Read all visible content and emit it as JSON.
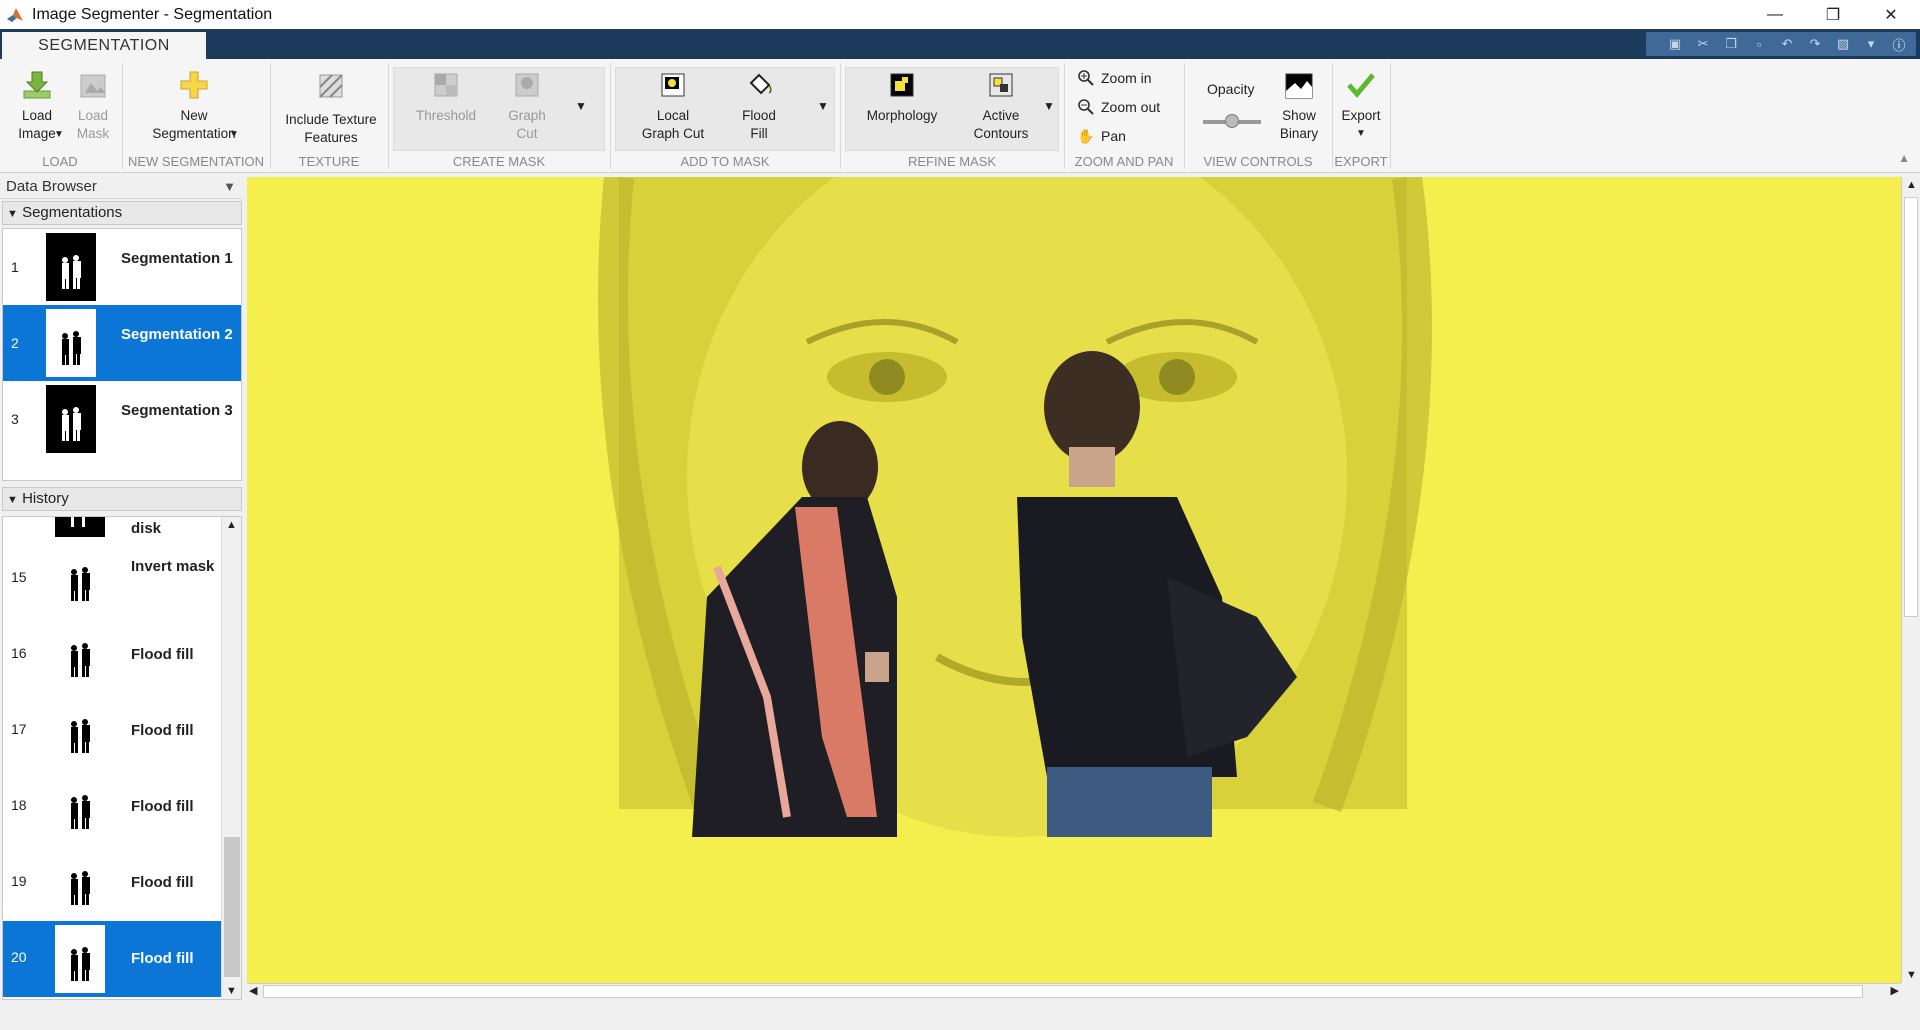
{
  "window": {
    "title": "Image Segmenter - Segmentation"
  },
  "tabs": {
    "active": "SEGMENTATION"
  },
  "toolstrip": {
    "load": {
      "label": "LOAD",
      "load_image": "Load\nImage",
      "load_mask": "Load\nMask"
    },
    "new_segmentation": {
      "label": "NEW SEGMENTATION",
      "button": "New\nSegmentation"
    },
    "texture": {
      "label": "TEXTURE",
      "button": "Include Texture\nFeatures"
    },
    "create_mask": {
      "label": "CREATE MASK",
      "threshold": "Threshold",
      "graph_cut": "Graph\nCut"
    },
    "add_to_mask": {
      "label": "ADD TO MASK",
      "local_graph_cut": "Local\nGraph Cut",
      "flood_fill": "Flood\nFill"
    },
    "refine_mask": {
      "label": "REFINE MASK",
      "morphology": "Morphology",
      "active_contours": "Active\nContours"
    },
    "zoom_pan": {
      "label": "ZOOM AND PAN",
      "zoom_in": "Zoom in",
      "zoom_out": "Zoom out",
      "pan": "Pan"
    },
    "view_controls": {
      "label": "VIEW CONTROLS",
      "opacity": "Opacity",
      "show_binary": "Show\nBinary"
    },
    "export": {
      "label": "EXPORT",
      "button": "Export"
    }
  },
  "data_browser": {
    "title": "Data Browser",
    "segmentations_header": "Segmentations",
    "segmentations": [
      {
        "num": "1",
        "label": "Segmentation 1",
        "thumb": "black"
      },
      {
        "num": "2",
        "label": "Segmentation 2",
        "thumb": "white"
      },
      {
        "num": "3",
        "label": "Segmentation 3",
        "thumb": "black"
      }
    ],
    "history_header": "History",
    "history": [
      {
        "num": "",
        "label": "disk"
      },
      {
        "num": "15",
        "label": "Invert mask"
      },
      {
        "num": "16",
        "label": "Flood fill"
      },
      {
        "num": "17",
        "label": "Flood fill"
      },
      {
        "num": "18",
        "label": "Flood fill"
      },
      {
        "num": "19",
        "label": "Flood fill"
      },
      {
        "num": "20",
        "label": "Flood fill"
      }
    ]
  },
  "colors": {
    "accent": "#0c76d6",
    "mask_overlay": "#f4ef4c",
    "tabstrip": "#1b3a5c"
  }
}
